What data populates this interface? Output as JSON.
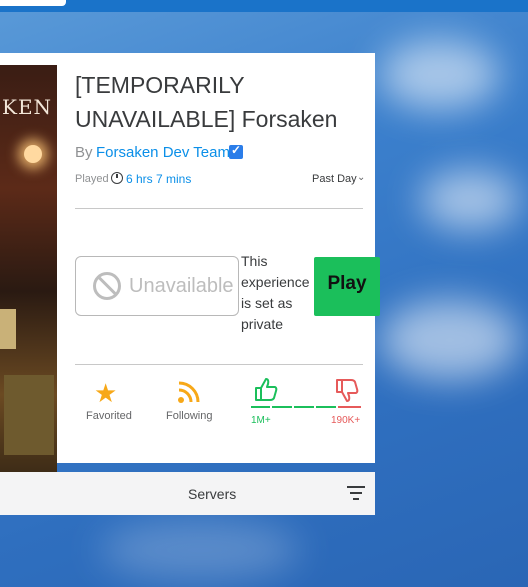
{
  "game": {
    "title": "[TEMPORARILY UNAVAILABLE] Forsaken",
    "by_label": "By",
    "creator": "Forsaken Dev Team",
    "played_label": "Played",
    "playtime": "6 hrs 7 mins",
    "range": "Past Day",
    "thumbnail_text": "KEN"
  },
  "actions": {
    "unavailable_label": "Unavailable",
    "private_message": "This experience is set as private",
    "play_label": "Play"
  },
  "social": {
    "favorited_label": "Favorited",
    "following_label": "Following",
    "upvotes": "1M+",
    "downvotes": "190K+"
  },
  "servers": {
    "label": "Servers"
  },
  "colors": {
    "play": "#1bbf5b",
    "link": "#0b8fe8",
    "favorite_star": "#f7a818",
    "follow_rss": "#f7a818",
    "upvote": "#1bbf5b",
    "downvote": "#e65a5a",
    "verified_badge": "#2b7de9"
  },
  "icons": [
    "clock-icon",
    "chevron-down-icon",
    "verified-badge-icon",
    "ban-icon",
    "star-icon",
    "rss-icon",
    "thumbs-up-icon",
    "thumbs-down-icon",
    "filter-icon"
  ]
}
